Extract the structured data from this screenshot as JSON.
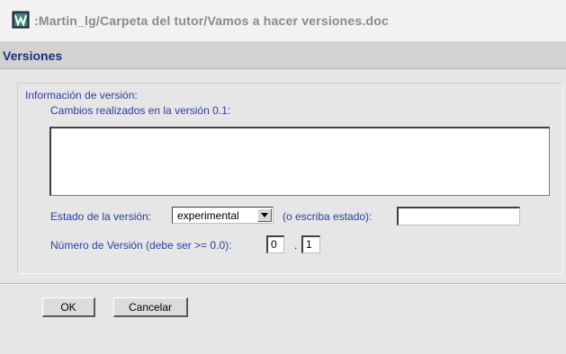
{
  "window": {
    "title": ":Martin_lg/Carpeta del tutor/Vamos a hacer versiones.doc",
    "icon": "word-document-icon"
  },
  "header": {
    "heading": "Versiones"
  },
  "form": {
    "group_label": "Información de versión:",
    "changes_label": "Cambios realizados en la versión 0.1:",
    "changes_value": "",
    "state_label": "Estado de la versión:",
    "state_selected": "experimental",
    "state_alt_label": "(o escriba estado):",
    "state_alt_value": "",
    "version_label": "Número de Versión (debe ser >= 0.0):",
    "version_major": "0",
    "version_dot": ".",
    "version_minor": "1"
  },
  "buttons": {
    "ok": "OK",
    "cancel": "Cancelar"
  }
}
